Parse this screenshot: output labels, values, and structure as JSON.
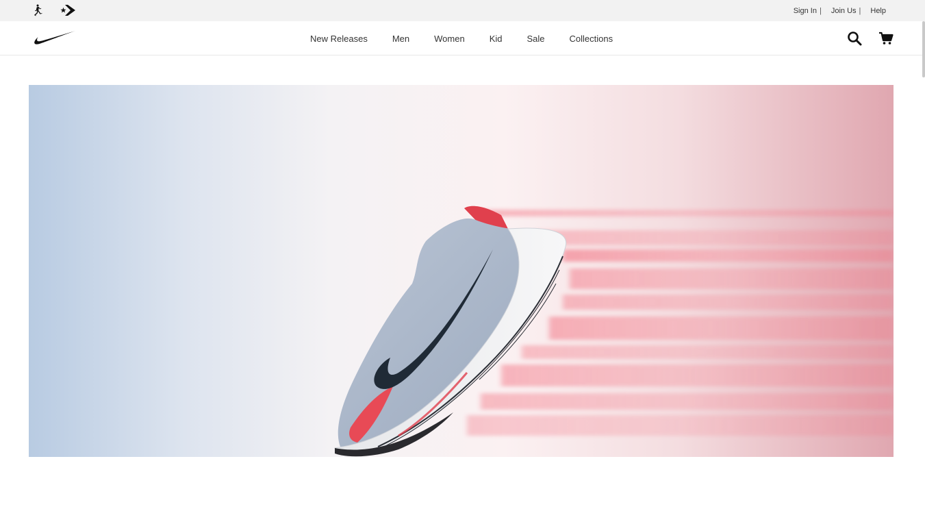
{
  "utility_bar": {
    "brands": [
      {
        "name": "jordan-jumpman"
      },
      {
        "name": "converse-star-chevron"
      }
    ],
    "links": [
      {
        "label": "Sign In",
        "sep": "|"
      },
      {
        "label": "Join Us",
        "sep": "|"
      },
      {
        "label": "Help",
        "sep": ""
      }
    ]
  },
  "header": {
    "logo": "nike-swoosh",
    "nav": [
      {
        "label": "New Releases"
      },
      {
        "label": "Men"
      },
      {
        "label": "Women"
      },
      {
        "label": "Kid"
      },
      {
        "label": "Sale"
      },
      {
        "label": "Collections"
      }
    ],
    "icons": {
      "search": "search-icon",
      "cart": "cart-icon"
    }
  },
  "hero": {
    "image": "running-shoe-speed-blur",
    "colors": {
      "left": "#b8cbe2",
      "right": "#e0a7b0",
      "blur": "#f26d7d",
      "upper": "#a9b6c9",
      "swoosh": "#1f2a36"
    }
  }
}
